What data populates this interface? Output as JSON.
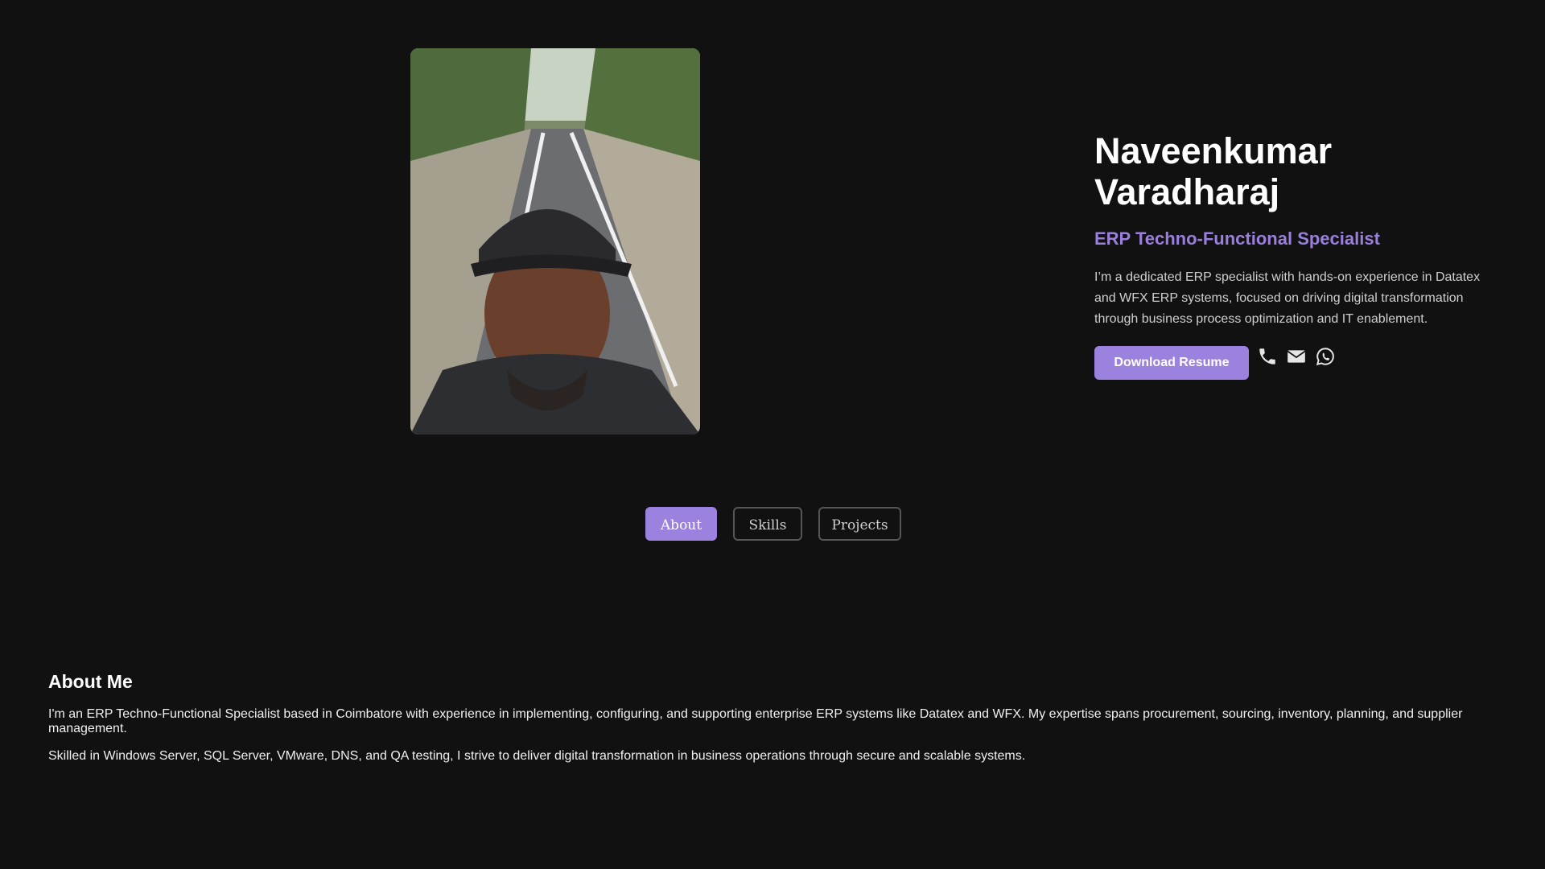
{
  "hero": {
    "name": "Naveenkumar Varadharaj",
    "role": "ERP Techno-Functional Specialist",
    "bio": "I’m a dedicated ERP specialist with hands-on experience in Datatex and WFX ERP systems, focused on driving digital transformation through business process optimization and IT enablement.",
    "resume_label": "Download Resume",
    "contact_icons": [
      "phone-icon",
      "envelope-icon",
      "whatsapp-icon"
    ]
  },
  "tabs": [
    {
      "label": "About",
      "active": true
    },
    {
      "label": "Skills",
      "active": false
    },
    {
      "label": "Projects",
      "active": false
    }
  ],
  "about": {
    "title": "About Me",
    "paragraphs": [
      "I'm an ERP Techno-Functional Specialist based in Coimbatore with experience in implementing, configuring, and supporting enterprise ERP systems like Datatex and WFX. My expertise spans procurement, sourcing, inventory, planning, and supplier management.",
      "Skilled in Windows Server, SQL Server, VMware, DNS, and QA testing, I strive to deliver digital transformation in business operations through secure and scalable systems."
    ]
  },
  "colors": {
    "accent": "#9c82df",
    "background": "#111112",
    "role_text": "#9a7fdc"
  }
}
